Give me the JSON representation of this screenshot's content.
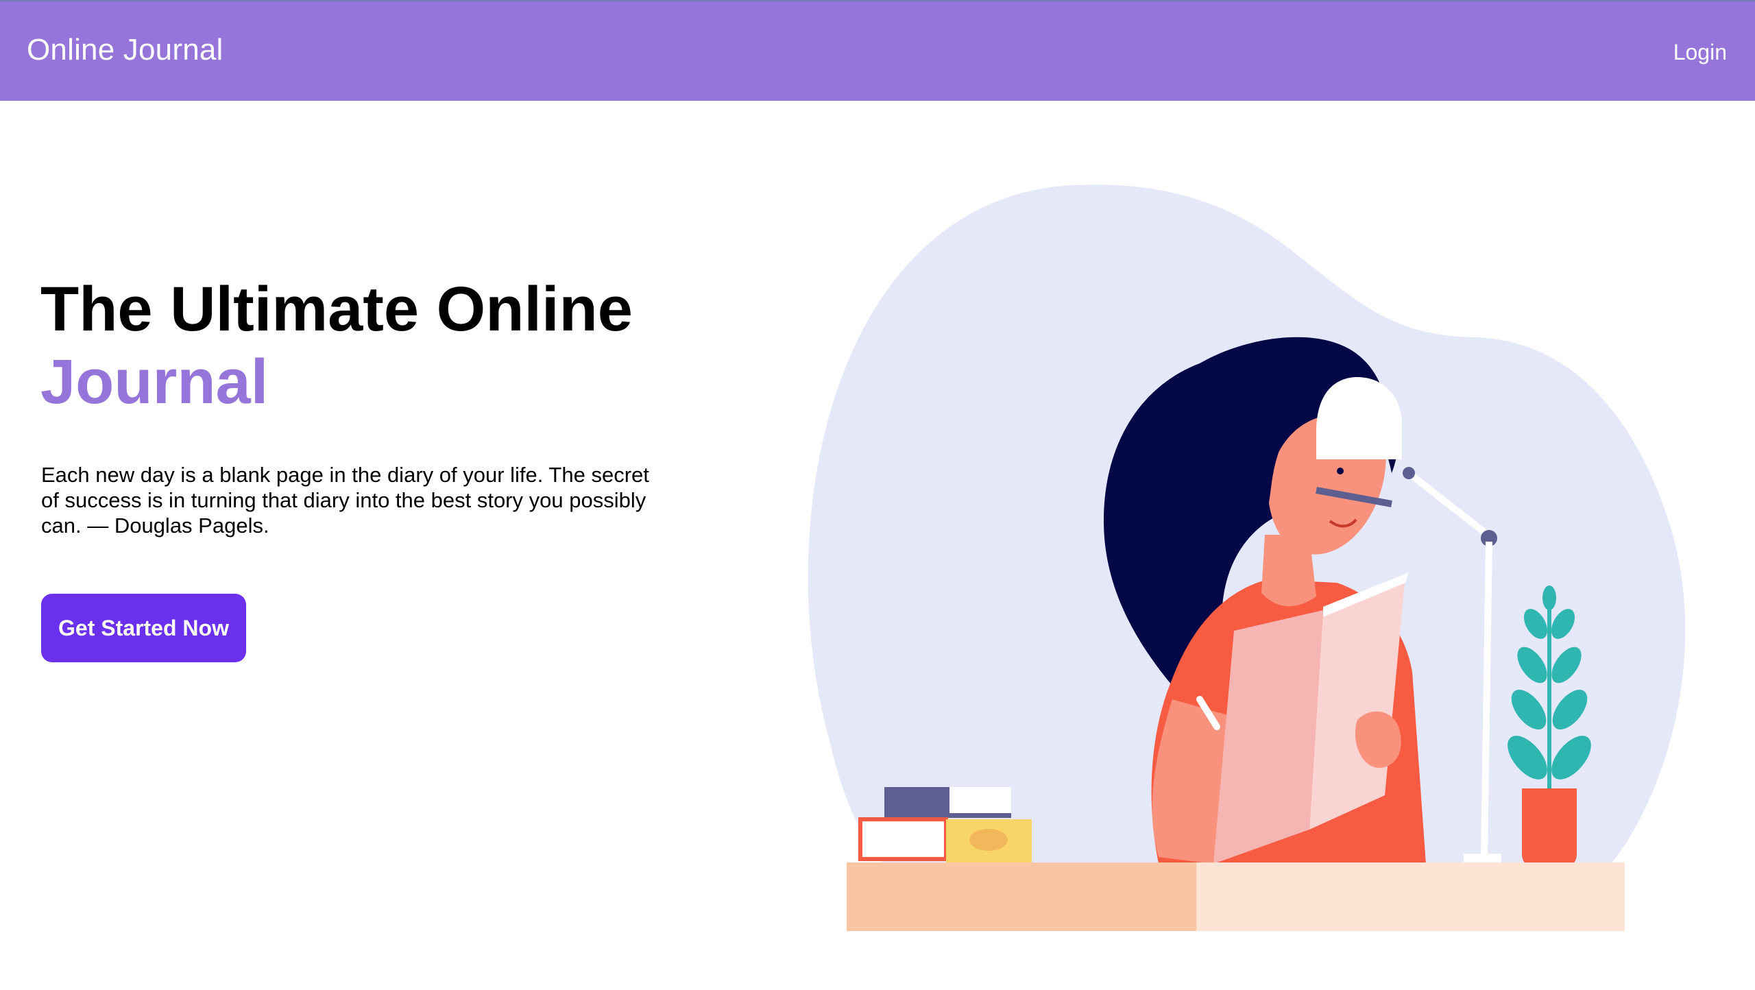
{
  "navbar": {
    "brand": "Online Journal",
    "login_label": "Login",
    "color": "#9575d9"
  },
  "hero": {
    "title_line1": "The Ultimate Online",
    "title_line2": "Journal",
    "quote": "Each new day is a blank page in the diary of your life. The secret of success is in turning that diary into the best story you possibly can. — Douglas Pagels.",
    "cta_label": "Get Started Now",
    "cta_color": "#6a30ee",
    "accent_color": "#9575d9"
  },
  "illustration": {
    "subject": "woman-reading-journal-illustration"
  }
}
